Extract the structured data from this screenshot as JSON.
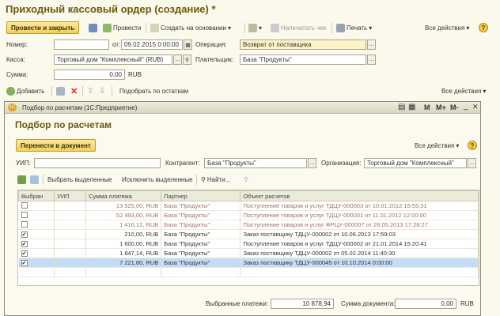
{
  "header": {
    "title": "Приходный кассовый ордер (создание) *"
  },
  "toolbar": {
    "post_close": "Провести и закрыть",
    "post": "Провести",
    "create_based": "Создать на основании",
    "print_receipt": "Напечатать чек",
    "print": "Печать",
    "all_actions": "Все действия"
  },
  "form": {
    "number_label": "Номер:",
    "number_value": "",
    "date_label": "от:",
    "date_value": "09.02.2015  0:00:00",
    "operation_label": "Операция:",
    "operation_value": "Возврат от поставщика",
    "cash_label": "Касса:",
    "cash_value": "Торговый дом \"Комплексный\" (RUB)",
    "payer_label": "Плательщик:",
    "payer_value": "База \"Продукты\"",
    "sum_label": "Сумма:",
    "sum_value": "0,00",
    "currency": "RUB"
  },
  "tabbar": {
    "add": "Добавить",
    "pick_balances": "Подобрать по остаткам",
    "all_actions": "Все действия"
  },
  "modal": {
    "window_title": "Подбор по расчетам  (1С:Предприятие)",
    "heading": "Подбор по расчетам",
    "transfer_btn": "Перенести в документ",
    "all_actions": "Все действия",
    "uip_label": "УИП:",
    "uip_value": "",
    "contractor_label": "Контрагент:",
    "contractor_value": "База \"Продукты\"",
    "org_label": "Организация:",
    "org_value": "Торговый дом \"Комплексный\"",
    "select_selected": "Выбрать выделенные",
    "exclude_selected": "Исключить выделенные",
    "find": "Найти...",
    "columns": [
      "Выбран",
      "УИП",
      "Сумма платежа",
      "Партнер",
      "Объект расчетов"
    ],
    "rows": [
      {
        "checked": false,
        "uip": "",
        "sum": "13 525,00, RUB",
        "partner": "База \"Продукты\"",
        "object": "Поступление товаров и услуг ТДЦУ-000003 от 10.01.2012 15:55:31",
        "style": "gray"
      },
      {
        "checked": false,
        "uip": "",
        "sum": "52 493,00, RUB",
        "partner": "База \"Продукты\"",
        "object": "Поступление товаров и услуг ТДЦУ-000001 от 11.01.2012 12:00:00",
        "style": "gray"
      },
      {
        "checked": false,
        "uip": "",
        "sum": "1 416,12, RUB",
        "partner": "База \"Продукты\"",
        "object": "Поступление товаров и услуг ФРЦУ-000007 от 28.05.2013 17:28:27",
        "style": "gray"
      },
      {
        "checked": true,
        "uip": "",
        "sum": "210,00, RUB",
        "partner": "База \"Продукты\"",
        "object": "Заказ поставщику ТДЦУ-000002 от 10.06.2013 17:59:03",
        "style": ""
      },
      {
        "checked": true,
        "uip": "",
        "sum": "1 600,00, RUB",
        "partner": "База \"Продукты\"",
        "object": "Поступление товаров и услуг ТДЦУ-000002 от 21.01.2014 15:20:41",
        "style": ""
      },
      {
        "checked": true,
        "uip": "",
        "sum": "1 847,14, RUB",
        "partner": "База \"Продукты\"",
        "object": "Заказ поставщику ТДЦУ-000002 от 05.02.2014 11:40:30",
        "style": ""
      },
      {
        "checked": true,
        "uip": "",
        "sum": "7 221,80, RUB",
        "partner": "База \"Продукты\"",
        "object": "Заказ поставщику ТДЦУ-000045 от 10.10.2014 0:00:00",
        "style": "sel"
      }
    ],
    "selected_label": "Выбранные платежи:",
    "selected_value": "10 878,94",
    "doc_sum_label": "Сумма документа:",
    "doc_sum_value": "0,00",
    "currency": "RUB"
  }
}
